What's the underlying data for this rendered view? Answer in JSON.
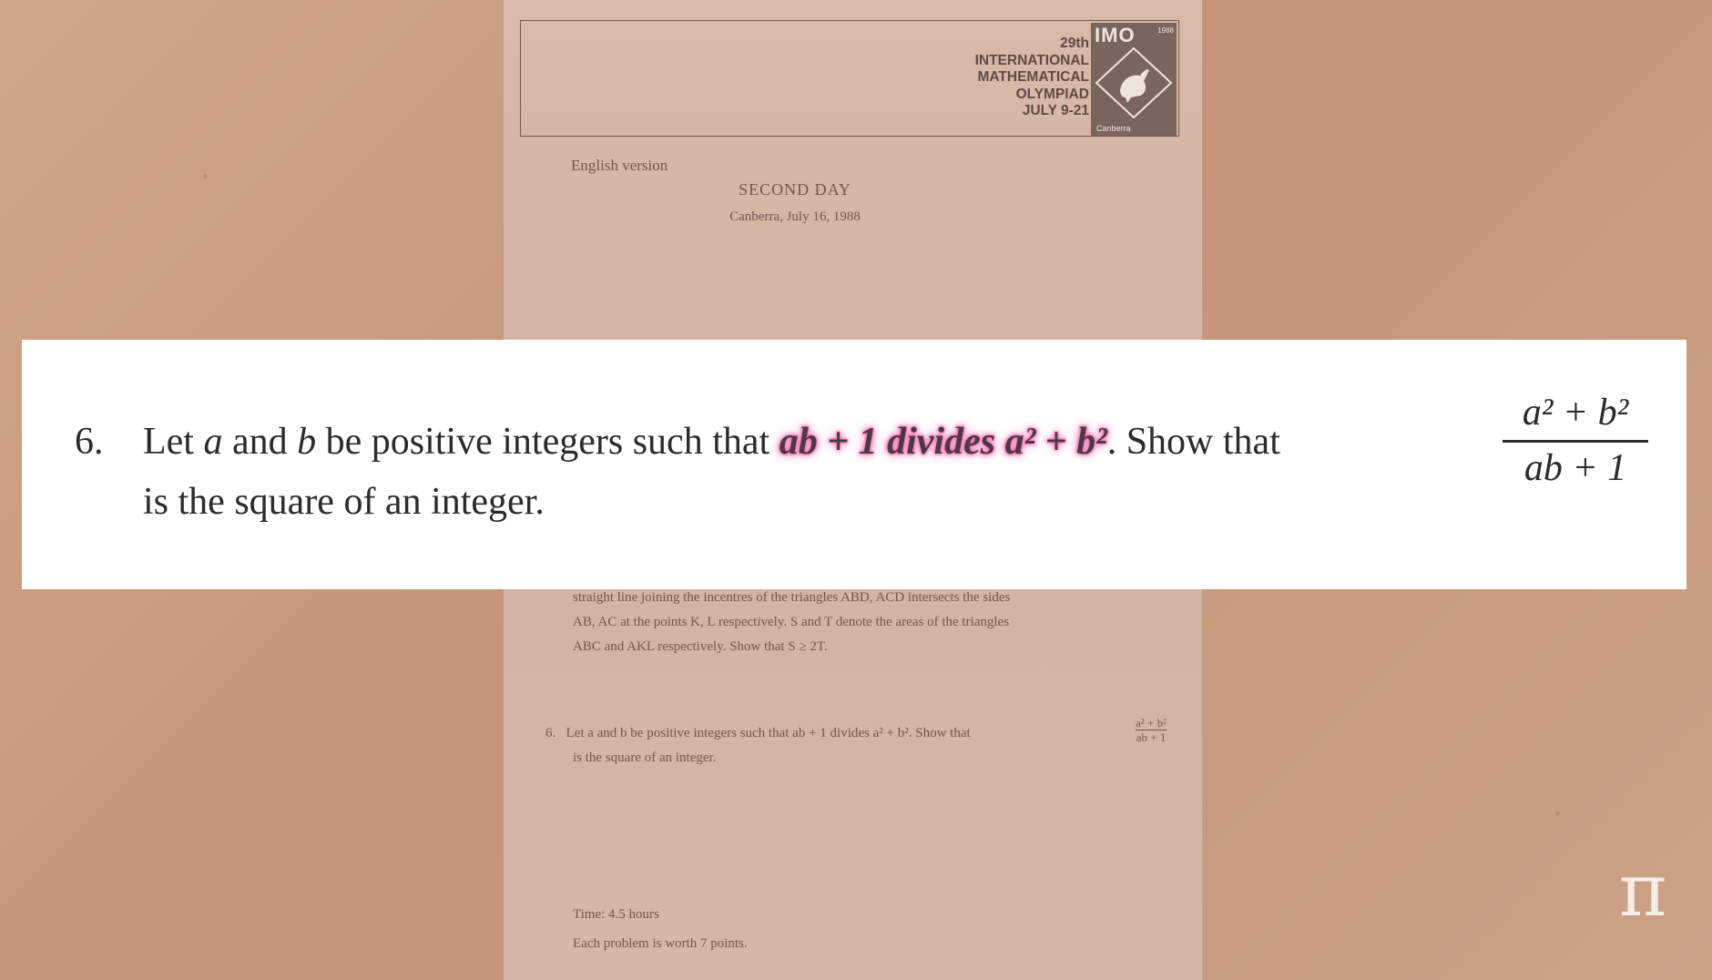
{
  "paper": {
    "imo_header": {
      "line1": "29th",
      "line2": "INTERNATIONAL",
      "line3": "MATHEMATICAL",
      "line4": "OLYMPIAD",
      "line5": "JULY 9-21",
      "logo_word": "IMO",
      "logo_year": "1988",
      "logo_city": "Canberra"
    },
    "version": "English version",
    "day": "SECOND DAY",
    "place_date": "Canberra, July 16, 1988",
    "problem5_lines": [
      "straight line joining the incentres of the triangles ABD, ACD intersects the sides",
      "AB, AC at the points K, L respectively. S and T denote the areas of the triangles",
      "ABC and AKL respectively. Show that S ≥ 2T."
    ],
    "problem6_small": {
      "number": "6.",
      "line1": "Let a and b be positive integers such that ab + 1 divides a² + b². Show that",
      "line2": "is the square of an integer.",
      "frac_num": "a² + b²",
      "frac_den": "ab + 1"
    },
    "time": "Time: 4.5 hours",
    "points": "Each problem is worth 7 points."
  },
  "banner": {
    "number": "6.",
    "text_before": "Let ",
    "var_a": "a",
    "text_and": " and ",
    "var_b": "b",
    "text_mid": " be positive integers such that ",
    "highlight": "ab + 1 divides a² + b²",
    "text_after": ". Show that",
    "line2": "is the square of an integer.",
    "frac_num": "a² + b²",
    "frac_den": "ab + 1"
  },
  "channel_logo": "π",
  "colors": {
    "background": "#c79a7d",
    "paper": "#d4b4a3",
    "banner": "#ffffff",
    "highlight_glow": "#ff5fa7"
  }
}
